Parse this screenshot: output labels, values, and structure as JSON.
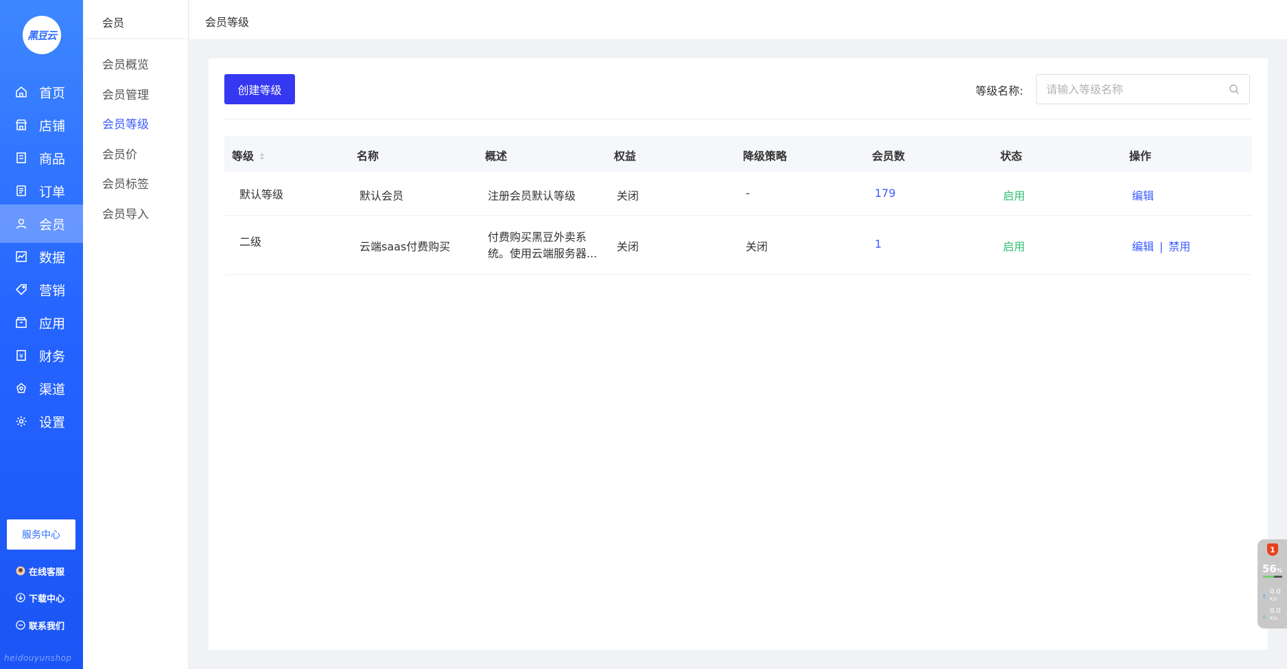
{
  "nav": {
    "logo_text": "黑豆云",
    "items": [
      {
        "label": "首页",
        "icon": "home-icon"
      },
      {
        "label": "店铺",
        "icon": "shop-icon"
      },
      {
        "label": "商品",
        "icon": "goods-icon"
      },
      {
        "label": "订单",
        "icon": "order-icon"
      },
      {
        "label": "会员",
        "icon": "user-icon",
        "active": true
      },
      {
        "label": "数据",
        "icon": "chart-icon"
      },
      {
        "label": "营销",
        "icon": "tag-icon"
      },
      {
        "label": "应用",
        "icon": "app-icon"
      },
      {
        "label": "财务",
        "icon": "finance-icon"
      },
      {
        "label": "渠道",
        "icon": "channel-icon"
      },
      {
        "label": "设置",
        "icon": "gear-icon"
      }
    ],
    "service_center": "服务中心",
    "links": [
      {
        "label": "在线客服",
        "icon": "avatar-icon"
      },
      {
        "label": "下载中心",
        "icon": "download-icon"
      },
      {
        "label": "联系我们",
        "icon": "contact-icon"
      }
    ],
    "watermark": "heidouyunshop"
  },
  "subnav": {
    "title": "会员",
    "items": [
      "会员概览",
      "会员管理",
      "会员等级",
      "会员价",
      "会员标签",
      "会员导入"
    ],
    "active": "会员等级"
  },
  "header": {
    "breadcrumb": "会员等级"
  },
  "toolbar": {
    "create_label": "创建等级",
    "filter_label": "等级名称:",
    "search_placeholder": "请输入等级名称"
  },
  "table": {
    "columns": [
      "等级",
      "名称",
      "概述",
      "权益",
      "降级策略",
      "会员数",
      "状态",
      "操作"
    ],
    "rows": [
      {
        "level": "默认等级",
        "name": "默认会员",
        "desc": "注册会员默认等级",
        "benefit": "关闭",
        "downgrade": "-",
        "members": "179",
        "status": "启用",
        "actions": [
          "编辑"
        ]
      },
      {
        "level": "二级",
        "name": "云端saas付费购买",
        "desc": "付费购买黑豆外卖系统。使用云端服务器...",
        "benefit": "关闭",
        "downgrade": "关闭",
        "members": "1",
        "status": "启用",
        "actions": [
          "编辑",
          "禁用"
        ]
      }
    ]
  },
  "widget": {
    "badge": "1",
    "percent": "56",
    "percent_unit": "%",
    "up_speed": "0.0",
    "down_speed": "0.0",
    "speed_unit": "K/s"
  },
  "colors": {
    "nav_blue": "#2563ff",
    "accent": "#3b5bff",
    "button": "#3538f0",
    "success": "#2fbf71"
  }
}
